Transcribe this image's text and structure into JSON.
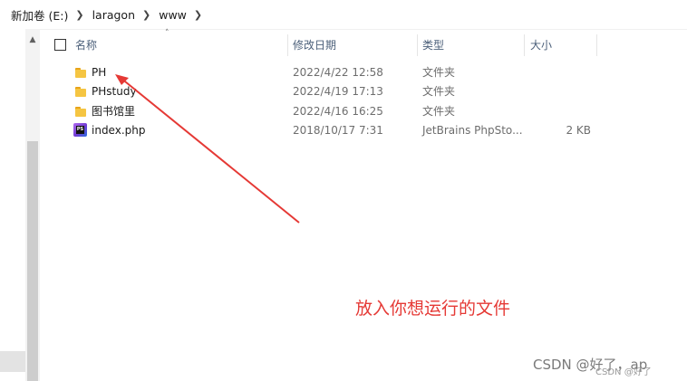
{
  "breadcrumb": {
    "items": [
      "新加卷 (E:)",
      "laragon",
      "www"
    ]
  },
  "columns": {
    "name": "名称",
    "date": "修改日期",
    "type": "类型",
    "size": "大小"
  },
  "files": [
    {
      "name": "PH",
      "date": "2022/4/22 12:58",
      "type": "文件夹",
      "size": "",
      "icon": "folder-icon"
    },
    {
      "name": "PHstudy",
      "date": "2022/4/19 17:13",
      "type": "文件夹",
      "size": "",
      "icon": "folder-icon"
    },
    {
      "name": "图书馆里",
      "date": "2022/4/16 16:25",
      "type": "文件夹",
      "size": "",
      "icon": "folder-icon"
    },
    {
      "name": "index.php",
      "date": "2018/10/17 7:31",
      "type": "JetBrains PhpSto...",
      "size": "2 KB",
      "icon": "phpstorm-file-icon"
    }
  ],
  "annotation": {
    "text": "放入你想运行的文件",
    "color": "#e53935"
  },
  "watermark": {
    "main": "CSDN @好了，ap",
    "secondary": "CSDN @好了"
  },
  "colors": {
    "folder": "#f5c542",
    "header_text": "#4c607a",
    "accent_red": "#e53935"
  }
}
